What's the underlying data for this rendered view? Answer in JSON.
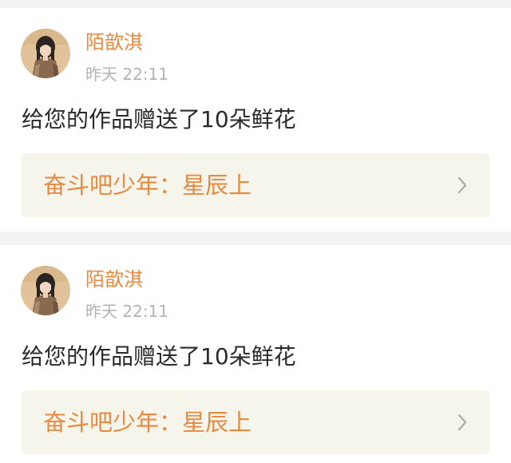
{
  "notifications": [
    {
      "user_name": "陌歆淇",
      "time": "昨天 22:11",
      "message": "给您的作品赠送了10朵鲜花",
      "work_title": "奋斗吧少年：星辰上"
    },
    {
      "user_name": "陌歆淇",
      "time": "昨天 22:11",
      "message": "给您的作品赠送了10朵鲜花",
      "work_title": "奋斗吧少年：星辰上"
    }
  ],
  "colors": {
    "accent": "#e8893f",
    "timestamp": "#b3b3b3",
    "message_text": "#2a2a2a",
    "link_background": "#f5f5ec",
    "card_background": "#ffffff",
    "page_background": "#f2f2f2"
  },
  "icons": {
    "avatar": "user-avatar-photo",
    "chevron": "chevron-right-icon"
  }
}
